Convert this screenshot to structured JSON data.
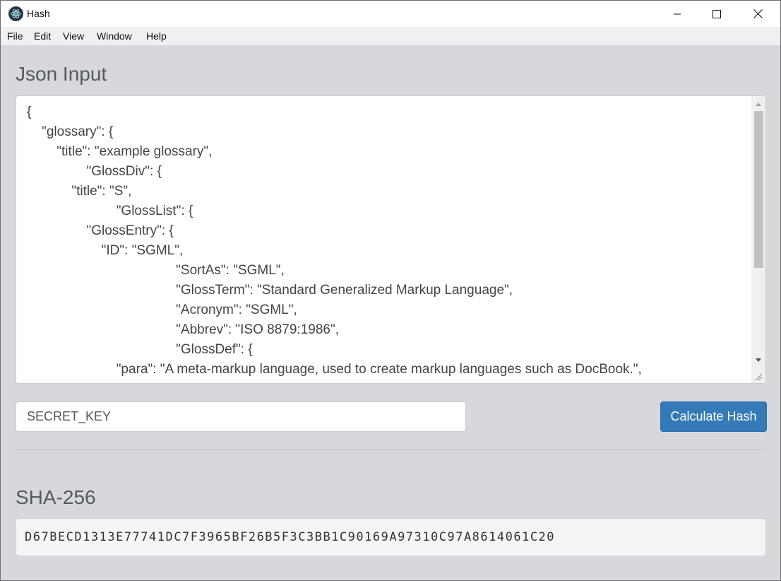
{
  "window": {
    "title": "Hash",
    "icon": "electron-app-icon",
    "controls": [
      "minimize-icon",
      "maximize-icon",
      "close-icon"
    ]
  },
  "menu": [
    "File",
    "Edit",
    "View",
    "Window",
    "Help"
  ],
  "json_section": {
    "heading": "Json Input",
    "content": "{\n    \"glossary\": {\n        \"title\": \"example glossary\",\n                \"GlossDiv\": {\n            \"title\": \"S\",\n                        \"GlossList\": {\n                \"GlossEntry\": {\n                    \"ID\": \"SGML\",\n                                        \"SortAs\": \"SGML\",\n                                        \"GlossTerm\": \"Standard Generalized Markup Language\",\n                                        \"Acronym\": \"SGML\",\n                                        \"Abbrev\": \"ISO 8879:1986\",\n                                        \"GlossDef\": {\n                        \"para\": \"A meta-markup language, used to create markup languages such as DocBook.\",\n                                                \"GlossSeeAlso\": [\"GML\", \"XML\"]"
  },
  "secret_key": {
    "value": "SECRET_KEY"
  },
  "calculate_button": {
    "label": "Calculate Hash"
  },
  "hash_section": {
    "heading": "SHA-256",
    "value": "D67BECD1313E77741DC7F3965BF26B5F3C3BB1C90169A97310C97A8614061C20"
  },
  "colors": {
    "accent": "#337ab7",
    "background": "#d6d8dc"
  }
}
